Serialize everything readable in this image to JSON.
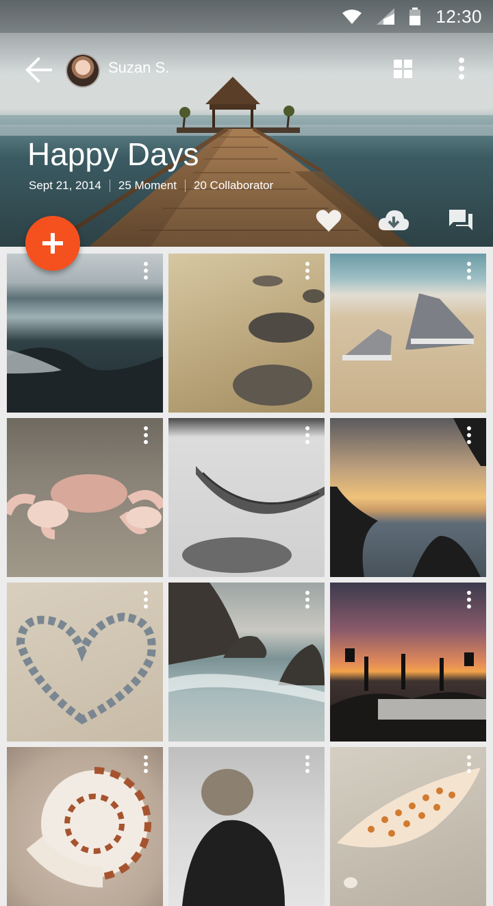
{
  "status_bar": {
    "time": "12:30"
  },
  "header": {
    "user_name": "Suzan S.",
    "album_title": "Happy Days",
    "meta": [
      "Sept 21, 2014",
      "25 Moment",
      "20 Collaborator"
    ]
  },
  "colors": {
    "accent": "#f4511e"
  },
  "icons": {
    "back": "arrow-left-icon",
    "grid": "grid-view-icon",
    "more": "more-vert-icon",
    "like": "heart-icon",
    "download": "cloud-download-icon",
    "comments": "comments-icon",
    "add": "plus-icon"
  },
  "photos": [
    "ocean wave",
    "beach stones",
    "sneakers on sand",
    "crab",
    "hammock",
    "sunset with palms",
    "heart of pebbles",
    "rocky coast",
    "concert at sunset",
    "nautilus shell",
    "woman reading on beach",
    "spotted seashell"
  ]
}
